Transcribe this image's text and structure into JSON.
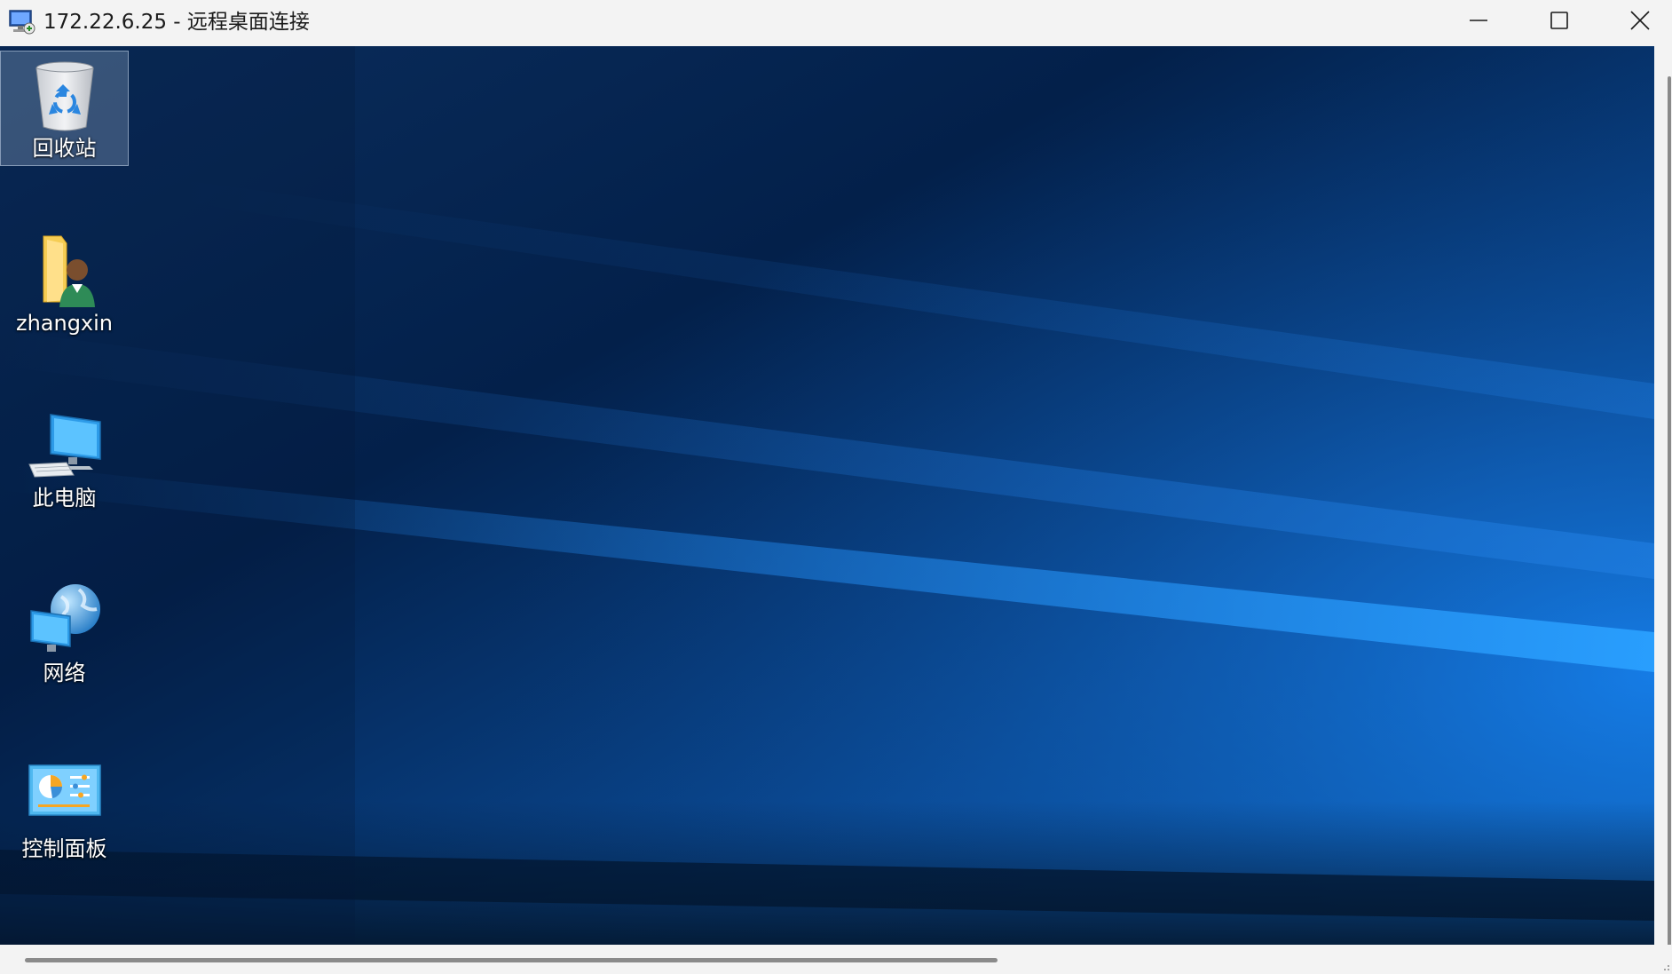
{
  "window": {
    "title": "172.22.6.25 - 远程桌面连接"
  },
  "titlebar_buttons": {
    "minimize_icon": "minimize-icon",
    "maximize_icon": "maximize-icon",
    "close_icon": "close-icon"
  },
  "desktop": {
    "icons": [
      {
        "label": "回收站",
        "icon": "recycle-bin-icon",
        "selected": true
      },
      {
        "label": "zhangxin",
        "icon": "user-folder-icon",
        "selected": false
      },
      {
        "label": "此电脑",
        "icon": "computer-icon",
        "selected": false
      },
      {
        "label": "网络",
        "icon": "network-icon",
        "selected": false
      },
      {
        "label": "控制面板",
        "icon": "control-panel-icon",
        "selected": false
      }
    ]
  },
  "colors": {
    "titlebar_bg": "#f3f3f3",
    "desktop_dark": "#031a3a",
    "desktop_light": "#0a78d6"
  }
}
